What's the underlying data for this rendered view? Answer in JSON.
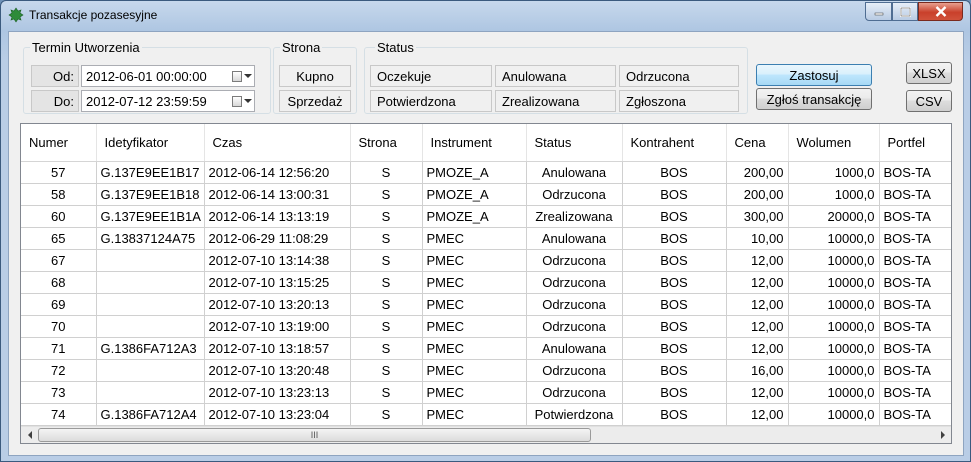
{
  "window": {
    "title": "Transakcje pozasesyjne"
  },
  "filters": {
    "termin": {
      "label": "Termin Utworzenia",
      "from_label": "Od:",
      "from_value": "2012-06-01 00:00:00",
      "to_label": "Do:",
      "to_value": "2012-07-12 23:59:59"
    },
    "strona": {
      "label": "Strona",
      "options": [
        "Kupno",
        "Sprzedaż"
      ]
    },
    "status": {
      "label": "Status",
      "options": [
        "Oczekuje",
        "Anulowana",
        "Odrzucona",
        "Potwierdzona",
        "Zrealizowana",
        "Zgłoszona"
      ]
    }
  },
  "buttons": {
    "apply": "Zastosuj",
    "report": "Zgłoś transakcję",
    "xlsx": "XLSX",
    "csv": "CSV"
  },
  "table": {
    "columns": [
      "Numer",
      "Idetyfikator",
      "Czas",
      "Strona",
      "Instrument",
      "Status",
      "Kontrahent",
      "Cena",
      "Wolumen",
      "Portfel"
    ],
    "rows": [
      [
        "57",
        "G.137E9EE1B17",
        "2012-06-14 12:56:20",
        "S",
        "PMOZE_A",
        "Anulowana",
        "BOS",
        "200,00",
        "1000,0",
        "BOS-TA"
      ],
      [
        "58",
        "G.137E9EE1B18",
        "2012-06-14 13:00:31",
        "S",
        "PMOZE_A",
        "Odrzucona",
        "BOS",
        "200,00",
        "1000,0",
        "BOS-TA"
      ],
      [
        "60",
        "G.137E9EE1B1A",
        "2012-06-14 13:13:19",
        "S",
        "PMOZE_A",
        "Zrealizowana",
        "BOS",
        "300,00",
        "20000,0",
        "BOS-TA"
      ],
      [
        "65",
        "G.13837124A75",
        "2012-06-29 11:08:29",
        "S",
        "PMEC",
        "Anulowana",
        "BOS",
        "10,00",
        "10000,0",
        "BOS-TA"
      ],
      [
        "67",
        "",
        "2012-07-10 13:14:38",
        "S",
        "PMEC",
        "Odrzucona",
        "BOS",
        "12,00",
        "10000,0",
        "BOS-TA"
      ],
      [
        "68",
        "",
        "2012-07-10 13:15:25",
        "S",
        "PMEC",
        "Odrzucona",
        "BOS",
        "12,00",
        "10000,0",
        "BOS-TA"
      ],
      [
        "69",
        "",
        "2012-07-10 13:20:13",
        "S",
        "PMEC",
        "Odrzucona",
        "BOS",
        "12,00",
        "10000,0",
        "BOS-TA"
      ],
      [
        "70",
        "",
        "2012-07-10 13:19:00",
        "S",
        "PMEC",
        "Odrzucona",
        "BOS",
        "12,00",
        "10000,0",
        "BOS-TA"
      ],
      [
        "71",
        "G.1386FA712A3",
        "2012-07-10 13:18:57",
        "S",
        "PMEC",
        "Anulowana",
        "BOS",
        "12,00",
        "10000,0",
        "BOS-TA"
      ],
      [
        "72",
        "",
        "2012-07-10 13:20:48",
        "S",
        "PMEC",
        "Odrzucona",
        "BOS",
        "16,00",
        "10000,0",
        "BOS-TA"
      ],
      [
        "73",
        "",
        "2012-07-10 13:23:13",
        "S",
        "PMEC",
        "Odrzucona",
        "BOS",
        "12,00",
        "10000,0",
        "BOS-TA"
      ],
      [
        "74",
        "G.1386FA712A4",
        "2012-07-10 13:23:04",
        "S",
        "PMEC",
        "Potwierdzona",
        "BOS",
        "12,00",
        "10000,0",
        "BOS-TA"
      ]
    ]
  },
  "scrollbar": {
    "grip": "III"
  }
}
